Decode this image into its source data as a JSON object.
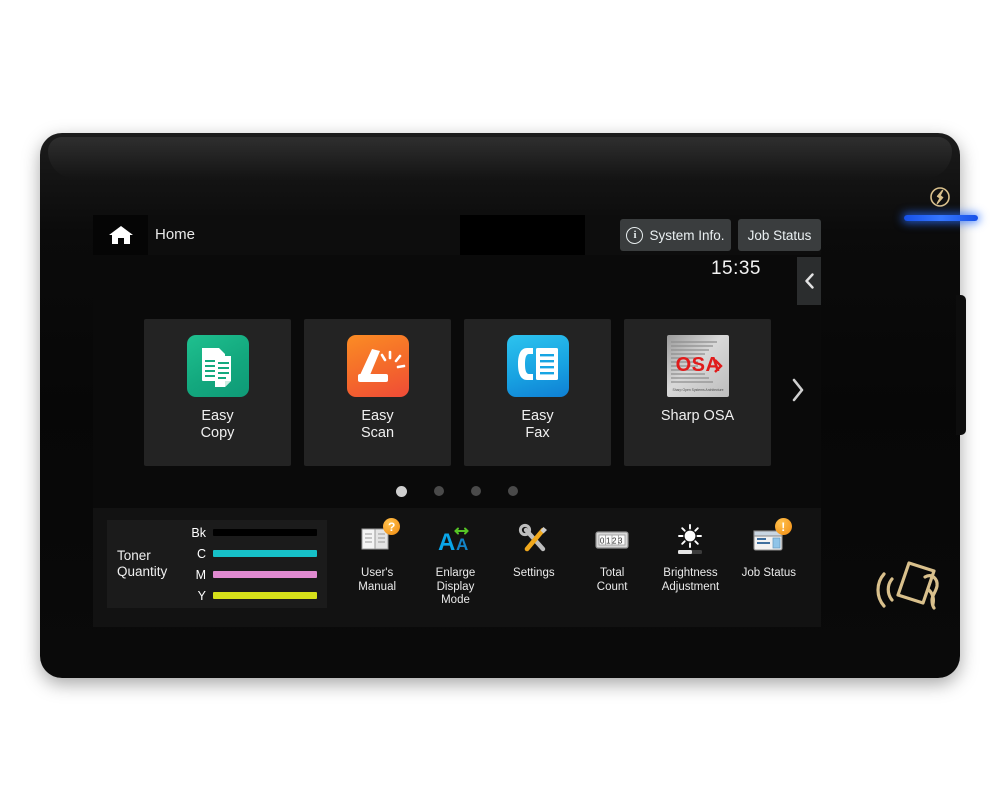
{
  "device": {
    "power_icon": "power-icon",
    "nfc_icon": "nfc-card-reader-icon"
  },
  "topbar": {
    "home_icon": "home-icon",
    "title": "Home",
    "system_info": {
      "label": "System Info.",
      "icon": "info-circle-icon"
    },
    "job_status": {
      "label": "Job Status"
    }
  },
  "status": {
    "time": "15:35",
    "left_tab_icon": "chevron-left-icon"
  },
  "apps": {
    "next_icon": "chevron-right-icon",
    "tiles": [
      {
        "label": "Easy\nCopy",
        "line1": "Easy",
        "line2": "Copy",
        "icon": "easy-copy-icon",
        "color": "#12b07f"
      },
      {
        "label": "Easy\nScan",
        "line1": "Easy",
        "line2": "Scan",
        "icon": "easy-scan-icon",
        "color": "#f2682a"
      },
      {
        "label": "Easy\nFax",
        "line1": "Easy",
        "line2": "Fax",
        "icon": "easy-fax-icon",
        "color": "#16a7e0"
      },
      {
        "label": "Sharp OSA",
        "line1": "Sharp OSA",
        "line2": "",
        "icon": "sharp-osa-icon",
        "color": "#c8c8c8"
      }
    ],
    "osa_logo_text": "OSA",
    "osa_caption": "Sharp Open Systems Architecture"
  },
  "pager": {
    "count": 4,
    "active": 0
  },
  "toner": {
    "title_line1": "Toner",
    "title_line2": "Quantity",
    "rows": [
      {
        "key": "Bk",
        "color": "#000000",
        "level": 100
      },
      {
        "key": "C",
        "color": "#16c0c8",
        "level": 100
      },
      {
        "key": "M",
        "color": "#e08ad0",
        "level": 100
      },
      {
        "key": "Y",
        "color": "#d6e01a",
        "level": 100
      }
    ]
  },
  "tools": [
    {
      "line1": "User's",
      "line2": "Manual",
      "line3": "",
      "icon": "users-manual-icon",
      "badge": "?"
    },
    {
      "line1": "Enlarge",
      "line2": "Display",
      "line3": "Mode",
      "icon": "enlarge-display-mode-icon",
      "badge": ""
    },
    {
      "line1": "Settings",
      "line2": "",
      "line3": "",
      "icon": "settings-icon",
      "badge": ""
    },
    {
      "line1": "Total",
      "line2": "Count",
      "line3": "",
      "icon": "total-count-icon",
      "badge": "",
      "counter": "0123"
    },
    {
      "line1": "Brightness",
      "line2": "Adjustment",
      "line3": "",
      "icon": "brightness-adjustment-icon",
      "badge": ""
    },
    {
      "line1": "Job Status",
      "line2": "",
      "line3": "",
      "icon": "job-status-icon",
      "badge": "!"
    }
  ],
  "colors": {
    "panel_bg": "#0a0a0a",
    "tile_bg": "#232323",
    "button_bg": "#3a3d3e",
    "led_blue": "#2f6fff",
    "accent_gold": "#d9c08c"
  }
}
